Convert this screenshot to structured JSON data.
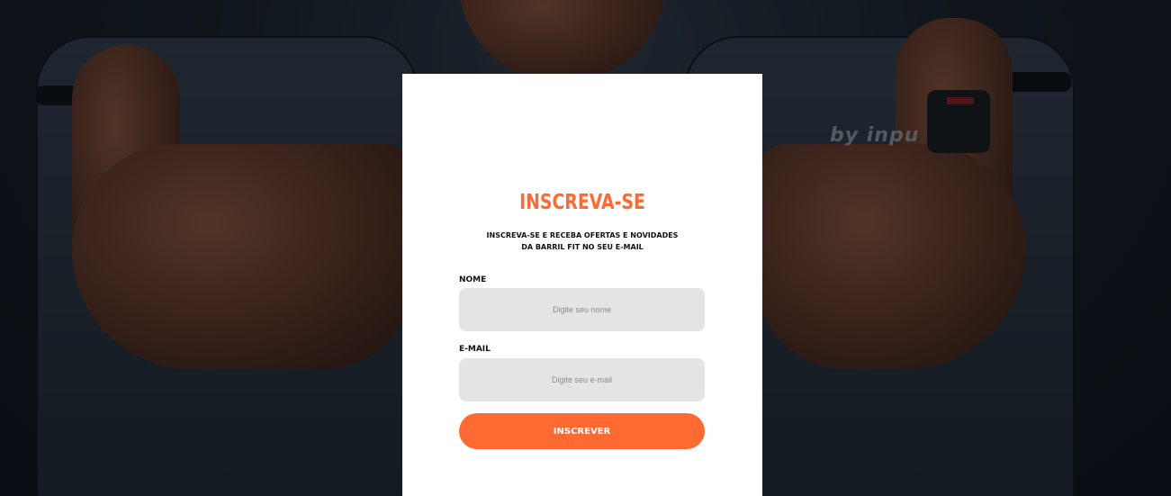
{
  "background": {
    "brand_text": "by inpu"
  },
  "modal": {
    "title": "INSCREVA-SE",
    "subtitle": "INSCREVA-SE E RECEBA OFERTAS E NOVIDADES DA BARRIL FIT NO SEU E-MAIL",
    "name_label": "NOME",
    "name_placeholder": "Digite seu nome",
    "email_label": "E-MAIL",
    "email_placeholder": "Digite seu e-mail",
    "submit_label": "INSCREVER"
  },
  "colors": {
    "accent": "#ff6a33",
    "field_bg": "#e4e4e4",
    "card_bg": "#ffffff"
  }
}
